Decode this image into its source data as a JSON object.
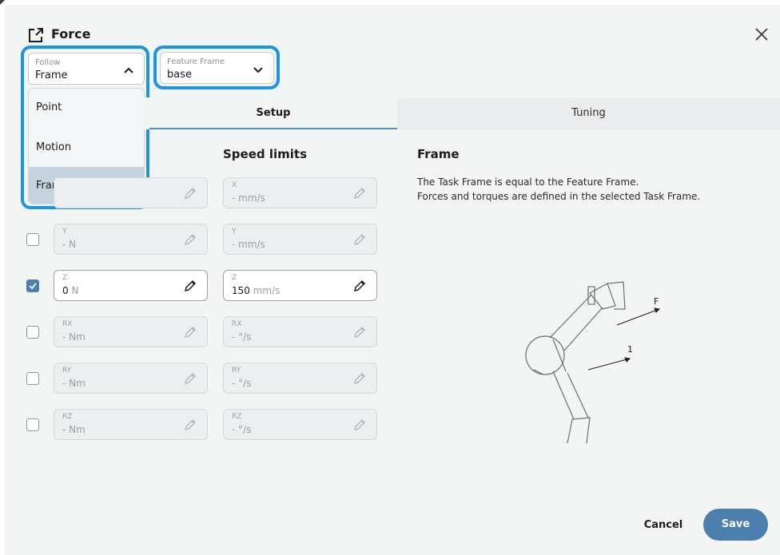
{
  "header": {
    "title": "Force",
    "icon": "external-link-icon",
    "close_icon": "close-icon"
  },
  "follow_select": {
    "label": "Follow",
    "value": "Frame",
    "options": [
      "Point",
      "Motion",
      "Frame"
    ]
  },
  "feature_frame_select": {
    "label": "Feature Frame",
    "value": "base"
  },
  "tabs": [
    {
      "label": "Setup",
      "active": true
    },
    {
      "label": "Tuning",
      "active": false
    }
  ],
  "speed_limits_title": "Speed limits",
  "rows": [
    {
      "axis": "X",
      "force_value": "",
      "force_unit": "",
      "speed_axis": "X",
      "speed_value": "- ",
      "speed_unit": "mm/s",
      "checked": null
    },
    {
      "axis": "Y",
      "force_value": "- ",
      "force_unit": "N",
      "speed_axis": "Y",
      "speed_value": "- ",
      "speed_unit": "mm/s",
      "checked": false
    },
    {
      "axis": "Z",
      "force_value": "0 ",
      "force_unit": "N",
      "speed_axis": "Z",
      "speed_value": "150 ",
      "speed_unit": "mm/s",
      "checked": true
    },
    {
      "axis": "RX",
      "force_value": "- ",
      "force_unit": "Nm",
      "speed_axis": "RX",
      "speed_value": "- ",
      "speed_unit": "°/s",
      "checked": false
    },
    {
      "axis": "RY",
      "force_value": "- ",
      "force_unit": "Nm",
      "speed_axis": "RY",
      "speed_value": "- ",
      "speed_unit": "°/s",
      "checked": false
    },
    {
      "axis": "RZ",
      "force_value": "- ",
      "force_unit": "Nm",
      "speed_axis": "RZ",
      "speed_value": "- ",
      "speed_unit": "°/s",
      "checked": false
    }
  ],
  "info": {
    "title": "Frame",
    "line1": "The Task Frame is equal to the Feature Frame.",
    "line2": "Forces and torques are defined in the selected Task Frame.",
    "diagram_labels": {
      "force": "F",
      "frame": "1"
    }
  },
  "footer": {
    "cancel_label": "Cancel",
    "save_label": "Save"
  },
  "colors": {
    "accent": "#4a7fae",
    "highlight": "#1d95e0",
    "selected_option": "#c5d3df"
  }
}
